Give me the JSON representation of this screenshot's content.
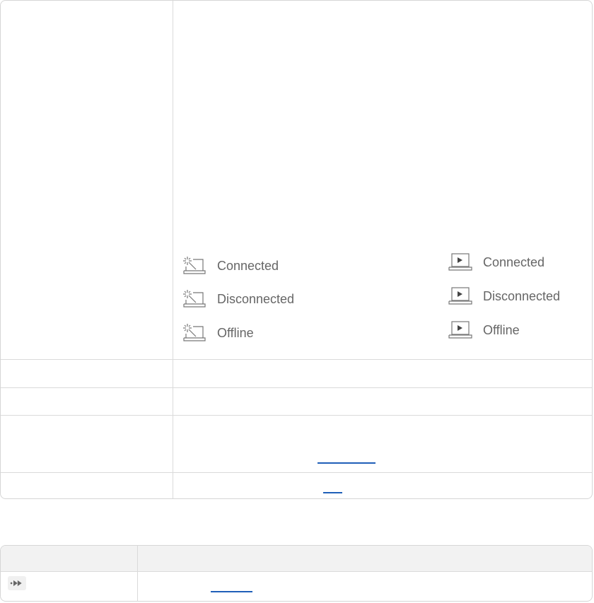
{
  "status_table": {
    "left_column": {
      "icon": "gear-monitor-icon",
      "items": [
        {
          "label": "Connected"
        },
        {
          "label": "Disconnected"
        },
        {
          "label": "Offline"
        }
      ]
    },
    "right_column": {
      "icon": "play-monitor-icon",
      "items": [
        {
          "label": "Connected"
        },
        {
          "label": "Disconnected"
        },
        {
          "label": "Offline"
        }
      ]
    }
  },
  "second_table": {
    "row_icon": "fast-forward-icon"
  },
  "colors": {
    "border": "#dadada",
    "header_shade": "#f2f2f2",
    "link": "#1f5fb8",
    "text": "#666666"
  }
}
